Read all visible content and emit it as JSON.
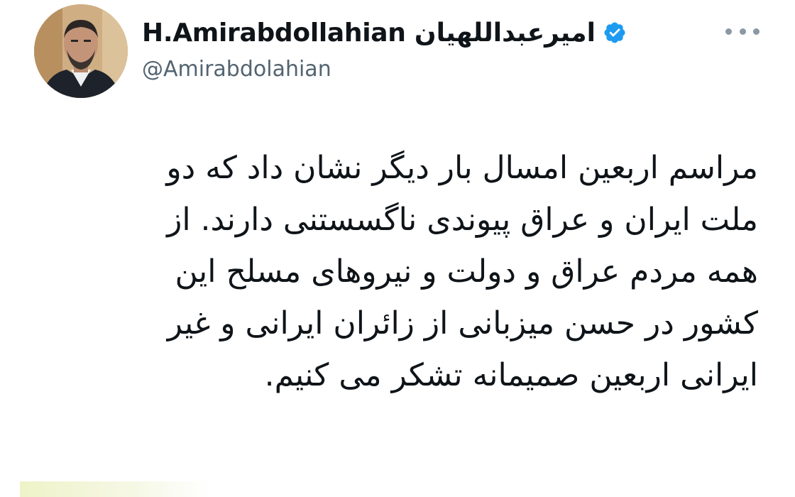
{
  "tweet": {
    "author": {
      "display_name": "H.Amirabdollahian امیرعبداللهیان",
      "handle": "@Amirabdolahian",
      "verified": true,
      "verified_icon": "verified-badge-icon",
      "avatar_icon": "profile-photo"
    },
    "more_icon": "more-options-icon",
    "text_lines": [
      "مراسم اربعین امسال بار دیگر نشان داد که دو",
      "ملت ایران و عراق پیوندی ناگسستنی دارند. از",
      "همه مردم عراق و دولت و نیروهای مسلح این",
      "کشور در حسن میزبانی از زائران ایرانی و غیر",
      "ایرانی اربعین صمیمانه تشکر می کنیم."
    ]
  },
  "colors": {
    "text": "#0f1419",
    "secondary": "#536471",
    "verified": "#1d9bf0",
    "more_dots": "#8b98a5"
  }
}
